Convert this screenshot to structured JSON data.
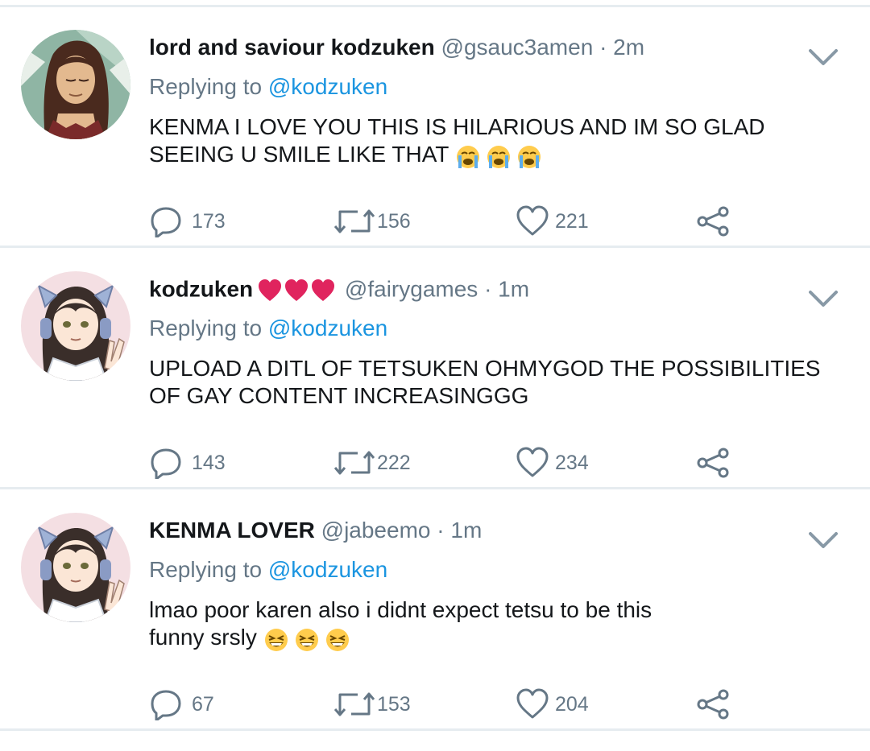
{
  "tweets": [
    {
      "name": "lord and saviour kodzuken",
      "handle": "@gsauc3amen",
      "time": "· 2m",
      "replying_prefix": "Replying to",
      "replying_to": "@kodzuken",
      "text": "KENMA I LOVE YOU THIS IS HILARIOUS AND IM SO GLAD SEEING U SMILE LIKE THAT",
      "emoji": "😭😭😭",
      "replies": "173",
      "retweets": "156",
      "likes": "221"
    },
    {
      "name": "kodzuken",
      "name_emoji": "❤❤❤",
      "handle": "@fairygames",
      "time": "· 1m",
      "replying_prefix": "Replying to",
      "replying_to": "@kodzuken",
      "text": "UPLOAD A DITL OF TETSUKEN OHMYGOD THE POSSIBILITIES OF GAY CONTENT INCREASINGGG",
      "replies": "143",
      "retweets": "222",
      "likes": "234"
    },
    {
      "name": "KENMA LOVER",
      "handle": "@jabeemo",
      "time": "· 1m",
      "replying_prefix": "Replying to",
      "replying_to": "@kodzuken",
      "text": "lmao poor karen also i didnt expect tetsu to be this funny srsly",
      "emoji": "😂😂😂",
      "replies": "67",
      "retweets": "153",
      "likes": "204"
    }
  ],
  "colors": {
    "text": "#14171a",
    "secondary": "#657786",
    "link": "#1b95e0",
    "divider": "#e6ecf0",
    "heart_red": "#e0245e"
  },
  "icons": [
    "reply-icon",
    "retweet-icon",
    "like-icon",
    "share-icon",
    "chevron-down-icon",
    "red-heart-icon",
    "crying-face-icon",
    "laughing-face-icon"
  ]
}
